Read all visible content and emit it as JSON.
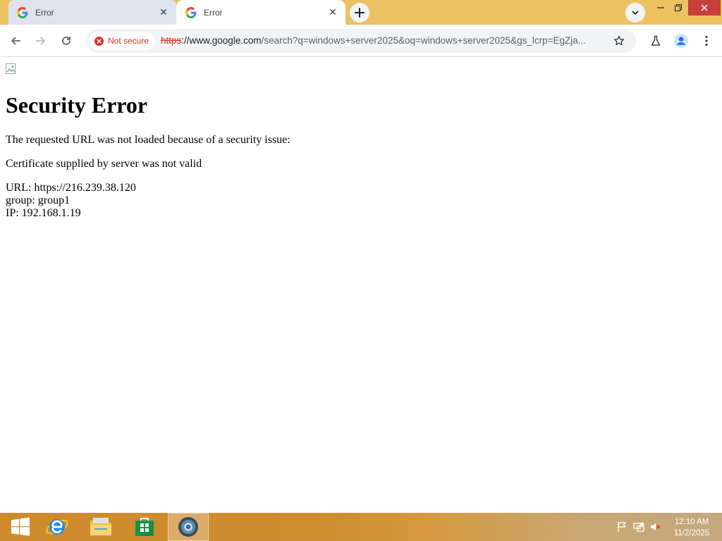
{
  "browser": {
    "tabs": [
      {
        "title": "Error",
        "active": false
      },
      {
        "title": "Error",
        "active": true
      }
    ],
    "toolbar": {
      "security_chip": "Not secure",
      "url_scheme": "https",
      "url_host": "://www.google.com",
      "url_rest": "/search?q=windows+server2025&oq=windows+server2025&gs_lcrp=EgZja..."
    }
  },
  "page": {
    "heading": "Security Error",
    "line1": "The requested URL was not loaded because of a security issue:",
    "line2": "Certificate supplied by server was not valid",
    "url_line": "URL: https://216.239.38.120",
    "group_line": "group: group1",
    "ip_line": "IP: 192.168.1.19"
  },
  "taskbar": {
    "time": "12:10 AM",
    "date": "11/2/2025"
  },
  "colors": {
    "tab_strip": "#ecc161",
    "not_secure": "#d93025",
    "close_button": "#c7403c"
  }
}
